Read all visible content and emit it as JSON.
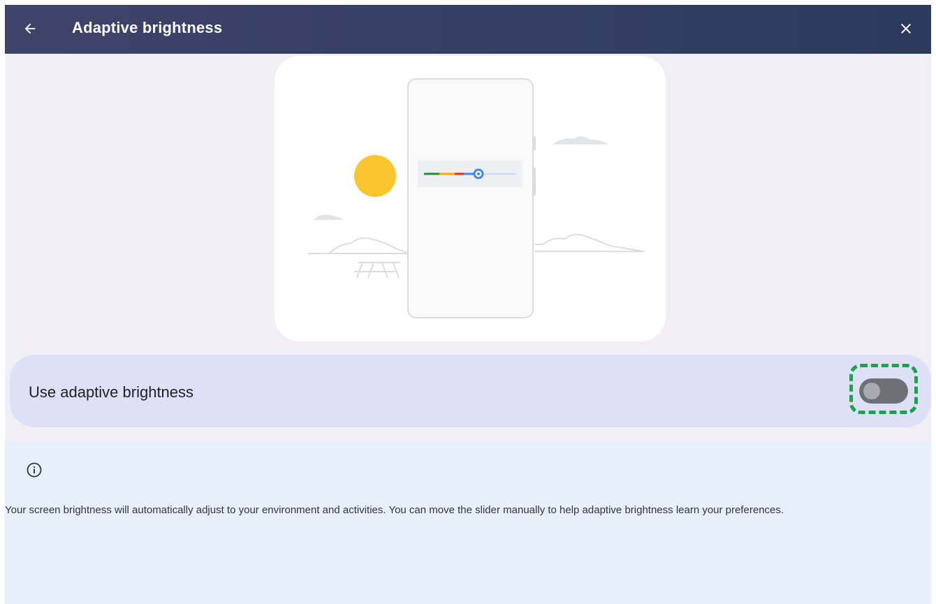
{
  "header": {
    "title": "Adaptive brightness",
    "back_icon": "arrow-back-icon",
    "close_icon": "close-icon"
  },
  "illustration": {
    "description_icon": "brightness-illustration",
    "sun_color": "#fbc52d",
    "slider_colors": [
      "#1e8e3e",
      "#f9ab00",
      "#d93025",
      "#4285f4"
    ]
  },
  "setting": {
    "label": "Use adaptive brightness",
    "toggle_state": "off",
    "highlight_color": "#1aa34a"
  },
  "info": {
    "icon": "info-icon",
    "text": "Your screen brightness will automatically adjust to your environment and activities. You can move the slider manually to help adaptive brightness learn your preferences."
  }
}
